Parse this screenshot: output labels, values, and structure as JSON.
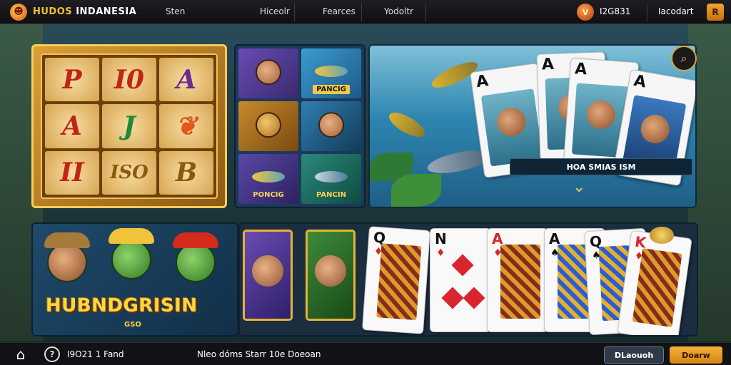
{
  "header": {
    "brand_part1": "HUDOS",
    "brand_part2": "INDANESIA",
    "nav": [
      "Sten",
      "Hiceolr",
      "Fearces",
      "Yodoltr"
    ],
    "balance": "I2G831",
    "account": "Iacodart",
    "coin_glyph": "V",
    "menu_glyph": "R"
  },
  "slot": {
    "symbols": [
      "P",
      "I0",
      "A",
      "A",
      "J",
      "",
      "II",
      "ISO",
      "B"
    ]
  },
  "character_grid": {
    "label_top": "PANCIG",
    "label_bottom_left": "PONCIG",
    "label_bottom_right": "PANCIN"
  },
  "fishing_tile": {
    "banner": "HOA SMIAS ISM",
    "card_ranks": [
      "A",
      "A",
      "A",
      "A"
    ]
  },
  "hub_tile": {
    "title": "HUBNDGRISIN",
    "subtitle": "GSO"
  },
  "cards_row": {
    "cards": [
      {
        "rank": "Q",
        "suit": "♦"
      },
      {
        "rank": "N",
        "suit": "♦"
      },
      {
        "rank": "A",
        "suit": "♦"
      },
      {
        "rank": "A",
        "suit": "♠"
      },
      {
        "rank": "Q",
        "suit": "♠"
      },
      {
        "rank": "K",
        "suit": "♦"
      }
    ]
  },
  "footer": {
    "friend": "I9O21 1 Fand",
    "promo": "Nleo dóms Starr 10e Doeoan",
    "login": "DLaouoh",
    "register": "Doarw"
  },
  "colors": {
    "accent": "#f2c03a",
    "register": "#e89a22",
    "background": "#1f3a3f"
  }
}
